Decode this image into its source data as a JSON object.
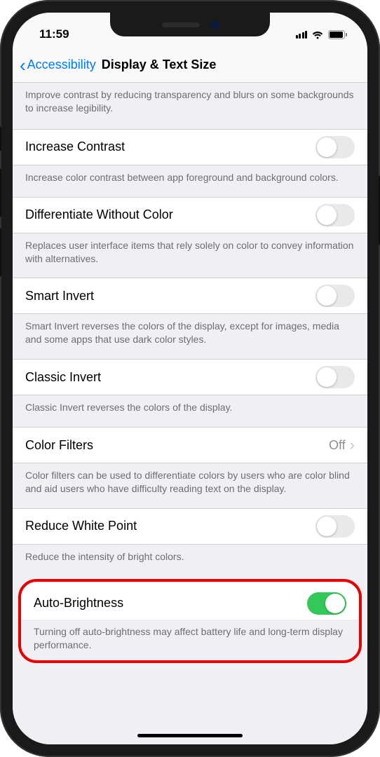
{
  "status": {
    "time": "11:59"
  },
  "nav": {
    "back_label": "Accessibility",
    "title": "Display & Text Size"
  },
  "group0": {
    "footer": "Improve contrast by reducing transparency and blurs on some backgrounds to increase legibility."
  },
  "rows": {
    "increase_contrast": {
      "label": "Increase Contrast",
      "on": false,
      "footer": "Increase color contrast between app foreground and background colors."
    },
    "diff_without_color": {
      "label": "Differentiate Without Color",
      "on": false,
      "footer": "Replaces user interface items that rely solely on color to convey information with alternatives."
    },
    "smart_invert": {
      "label": "Smart Invert",
      "on": false,
      "footer": "Smart Invert reverses the colors of the display, except for images, media and some apps that use dark color styles."
    },
    "classic_invert": {
      "label": "Classic Invert",
      "on": false,
      "footer": "Classic Invert reverses the colors of the display."
    },
    "color_filters": {
      "label": "Color Filters",
      "value": "Off",
      "footer": "Color filters can be used to differentiate colors by users who are color blind and aid users who have difficulty reading text on the display."
    },
    "reduce_white_point": {
      "label": "Reduce White Point",
      "on": false,
      "footer": "Reduce the intensity of bright colors."
    },
    "auto_brightness": {
      "label": "Auto-Brightness",
      "on": true,
      "footer": "Turning off auto-brightness may affect battery life and long-term display performance."
    }
  }
}
